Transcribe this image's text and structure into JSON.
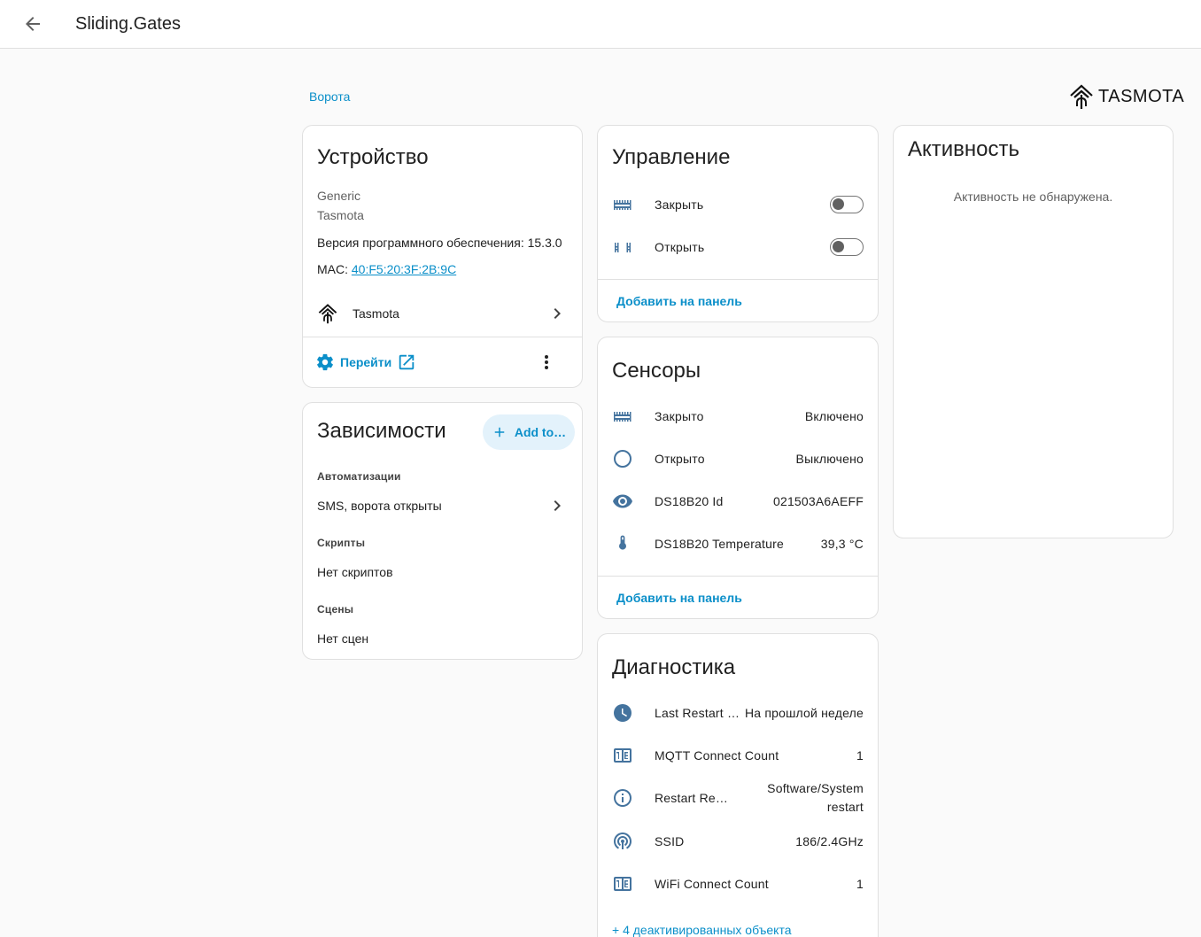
{
  "header": {
    "title": "Sliding.Gates"
  },
  "breadcrumb": "Ворота",
  "brand": {
    "name": "TASMOTA"
  },
  "device": {
    "title": "Устройство",
    "model": "Generic",
    "manufacturer": "Tasmota",
    "firmware": "Версия программного обеспечения: 15.3.0",
    "mac_label": "MAC: ",
    "mac_value": "40:F5:20:3F:2B:9C",
    "integration": "Tasmota",
    "goto_label": "Перейти"
  },
  "dependencies": {
    "title": "Зависимости",
    "add_label": "Add to…",
    "automations_label": "Автоматизации",
    "automation_item": "SMS, ворота открыты",
    "scripts_label": "Скрипты",
    "scripts_empty": "Нет скриптов",
    "scenes_label": "Сцены",
    "scenes_empty": "Нет сцен"
  },
  "controls": {
    "title": "Управление",
    "items": [
      {
        "name": "Закрыть",
        "icon": "gate-icon",
        "state": "off"
      },
      {
        "name": "Открыть",
        "icon": "gate-open-icon",
        "state": "off"
      }
    ],
    "add_label": "Добавить на панель"
  },
  "sensors": {
    "title": "Сенсоры",
    "items": [
      {
        "name": "Закрыто",
        "value": "Включено",
        "icon": "gate-icon"
      },
      {
        "name": "Открыто",
        "value": "Выключено",
        "icon": "circle-outline-icon"
      },
      {
        "name": "DS18B20 Id",
        "value": "021503A6AEFF",
        "icon": "eye-icon"
      },
      {
        "name": "DS18B20 Temperature",
        "value": "39,3 °C",
        "icon": "thermometer-icon"
      }
    ],
    "add_label": "Добавить на панель"
  },
  "diagnostics": {
    "title": "Диагностика",
    "items": [
      {
        "name": "Last Restart …",
        "value": "На прошлой неделе",
        "icon": "clock-icon"
      },
      {
        "name": "MQTT Connect Count",
        "value": "1",
        "icon": "counter-icon"
      },
      {
        "name": "Restart Re…",
        "value": "Software/System restart",
        "icon": "info-icon"
      },
      {
        "name": "SSID",
        "value": "186/2.4GHz",
        "icon": "access-point-icon"
      },
      {
        "name": "WiFi Connect Count",
        "value": "1",
        "icon": "counter-icon"
      }
    ],
    "disabled_link": "+ 4 деактивированных объекта"
  },
  "activity": {
    "title": "Активность",
    "empty": "Активность не обнаружена."
  },
  "colors": {
    "accent": "#0b8fc9",
    "icon": "#44739e"
  }
}
